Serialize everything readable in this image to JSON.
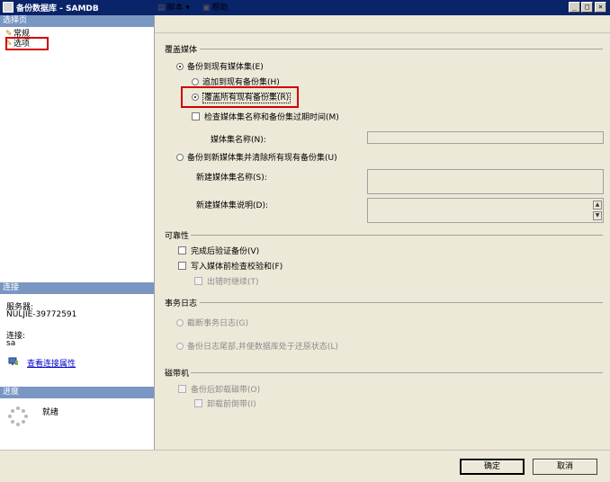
{
  "window": {
    "title": "备份数据库 - SAMDB",
    "btn_min": "_",
    "btn_max": "□",
    "btn_close": "×"
  },
  "left": {
    "select_page_header": "选择页",
    "pages": [
      {
        "label": "常规"
      },
      {
        "label": "选项"
      }
    ],
    "connection_header": "连接",
    "server_label": "服务器:",
    "server_value": "NULJIE-39772591",
    "conn_label": "连接:",
    "conn_value": "sa",
    "view_conn_props": "查看连接属性",
    "progress_header": "进度",
    "progress_status": "就绪"
  },
  "toolbar": {
    "script": "脚本",
    "script_arrow": "▾",
    "help": "帮助"
  },
  "overwrite_media": {
    "title": "覆盖媒体",
    "backup_existing": "备份到现有媒体集(E)",
    "append": "追加到现有备份集(H)",
    "overwrite_all": "覆盖所有现有备份集(R)",
    "check_media": "检查媒体集名称和备份集过期时间(M)",
    "media_set_name": "媒体集名称(N):",
    "backup_new": "备份到新媒体集并清除所有现有备份集(U)",
    "new_media_name": "新建媒体集名称(S):",
    "new_media_desc": "新建媒体集说明(D):"
  },
  "reliability": {
    "title": "可靠性",
    "verify": "完成后验证备份(V)",
    "checksum": "写入媒体前检查校验和(F)",
    "continue_on_error": "出错时继续(T)"
  },
  "transaction_log": {
    "title": "事务日志",
    "truncate": "截断事务日志(G)",
    "backup_tail": "备份日志尾部,并使数据库处于还原状态(L)"
  },
  "tape": {
    "title": "磁带机",
    "unload": "备份后卸载磁带(O)",
    "rewind": "卸载前倒带(I)"
  },
  "buttons": {
    "ok": "确定",
    "cancel": "取消"
  }
}
